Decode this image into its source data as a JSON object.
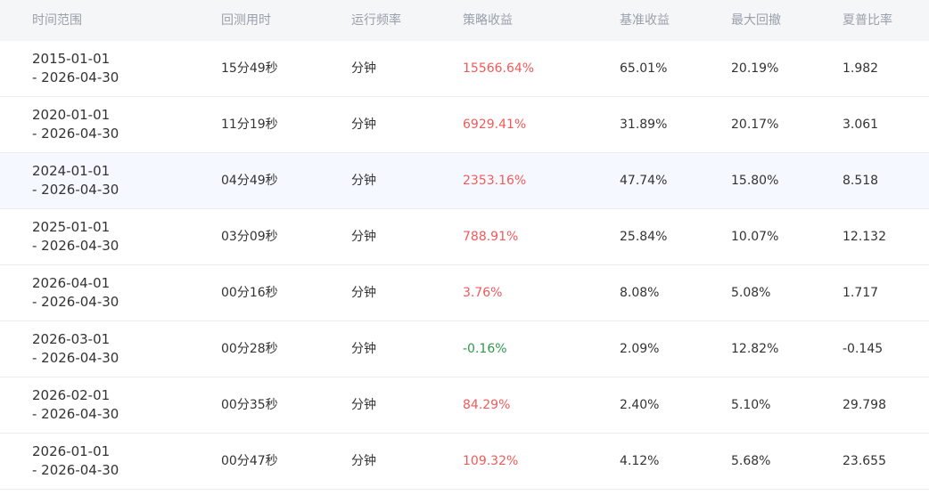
{
  "headers": {
    "time_range": "时间范围",
    "backtest_time": "回测用时",
    "frequency": "运行频率",
    "strategy_return": "策略收益",
    "benchmark_return": "基准收益",
    "max_drawdown": "最大回撤",
    "sharpe": "夏普比率"
  },
  "colors": {
    "positive": "#f25a5a",
    "negative": "#2e9a4a",
    "header_bg": "#f5f6f8",
    "highlight_bg": "#f5f9ff"
  },
  "rows": [
    {
      "start": "2015-01-01",
      "end": "- 2026-04-30",
      "duration": "15分49秒",
      "freq": "分钟",
      "strategy": "15566.64%",
      "benchmark": "65.01%",
      "drawdown": "20.19%",
      "sharpe": "1.982"
    },
    {
      "start": "2020-01-01",
      "end": "- 2026-04-30",
      "duration": "11分19秒",
      "freq": "分钟",
      "strategy": "6929.41%",
      "benchmark": "31.89%",
      "drawdown": "20.17%",
      "sharpe": "3.061"
    },
    {
      "start": "2024-01-01",
      "end": "- 2026-04-30",
      "duration": "04分49秒",
      "freq": "分钟",
      "strategy": "2353.16%",
      "benchmark": "47.74%",
      "drawdown": "15.80%",
      "sharpe": "8.518"
    },
    {
      "start": "2025-01-01",
      "end": "- 2026-04-30",
      "duration": "03分09秒",
      "freq": "分钟",
      "strategy": "788.91%",
      "benchmark": "25.84%",
      "drawdown": "10.07%",
      "sharpe": "12.132"
    },
    {
      "start": "2026-04-01",
      "end": "- 2026-04-30",
      "duration": "00分16秒",
      "freq": "分钟",
      "strategy": "3.76%",
      "benchmark": "8.08%",
      "drawdown": "5.08%",
      "sharpe": "1.717"
    },
    {
      "start": "2026-03-01",
      "end": "- 2026-04-30",
      "duration": "00分28秒",
      "freq": "分钟",
      "strategy": "-0.16%",
      "benchmark": "2.09%",
      "drawdown": "12.82%",
      "sharpe": "-0.145"
    },
    {
      "start": "2026-02-01",
      "end": "- 2026-04-30",
      "duration": "00分35秒",
      "freq": "分钟",
      "strategy": "84.29%",
      "benchmark": "2.40%",
      "drawdown": "5.10%",
      "sharpe": "29.798"
    },
    {
      "start": "2026-01-01",
      "end": "- 2026-04-30",
      "duration": "00分47秒",
      "freq": "分钟",
      "strategy": "109.32%",
      "benchmark": "4.12%",
      "drawdown": "5.68%",
      "sharpe": "23.655"
    }
  ]
}
